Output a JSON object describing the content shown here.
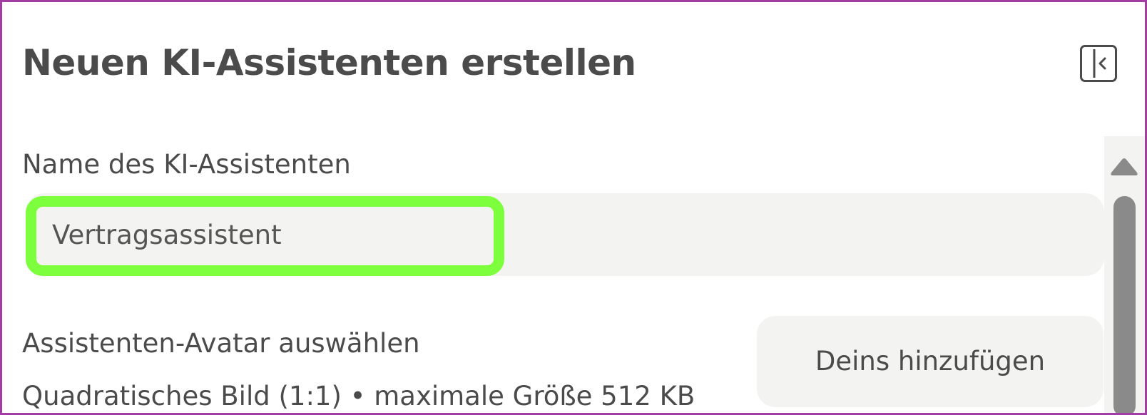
{
  "panel": {
    "title": "Neuen KI-Assistenten erstellen",
    "collapse_icon": "sidebar-collapse-icon"
  },
  "name_field": {
    "label": "Name des KI-Assistenten",
    "value": "Vertragsassistent",
    "highlight_color": "#7dff3e"
  },
  "avatar": {
    "title": "Assistenten-Avatar auswählen",
    "hint": "Quadratisches Bild (1:1) • maximale Größe 512 KB",
    "add_button_label": "Deins hinzufügen"
  },
  "colors": {
    "frame_border": "#a23da3",
    "field_background": "#f3f4f1",
    "text": "#4b4b4b",
    "scrollbar_thumb": "#8a8a8a"
  }
}
